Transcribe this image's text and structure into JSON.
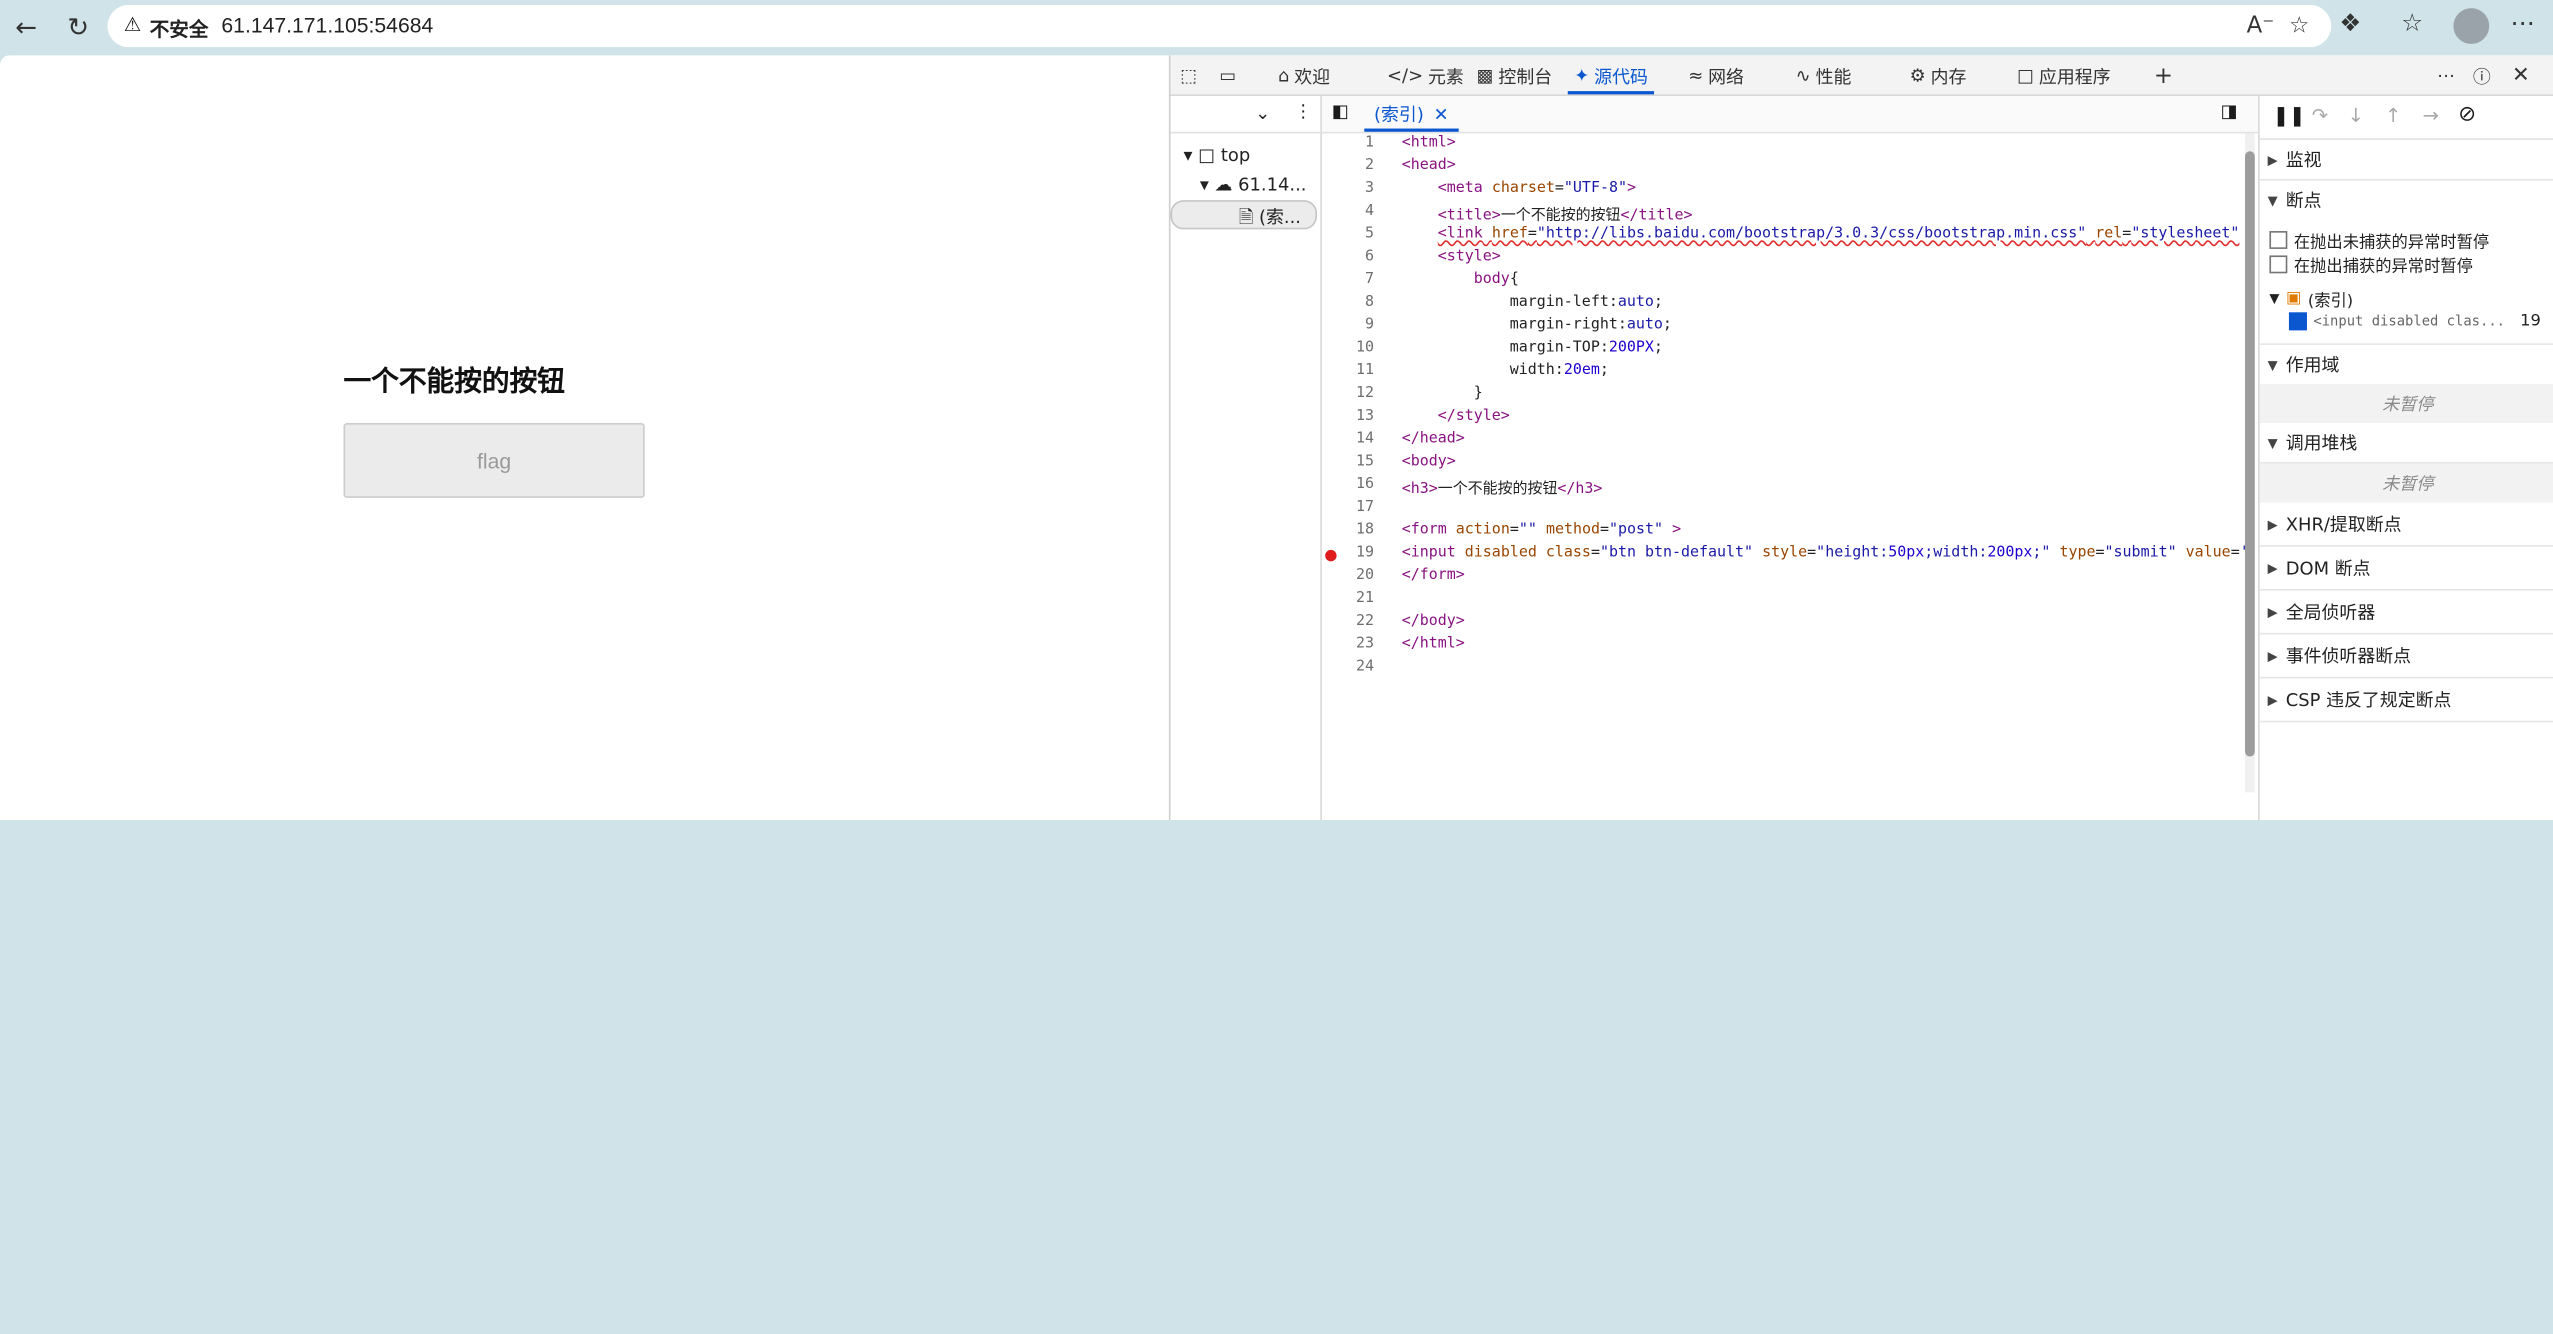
{
  "browser": {
    "insecure_label": "不安全",
    "url": "61.147.171.105:54684"
  },
  "page": {
    "heading": "一个不能按的按钮",
    "button_label": "flag"
  },
  "devtools": {
    "tabs": [
      {
        "label": "欢迎",
        "icon": "home-icon"
      },
      {
        "label": "元素",
        "icon": "code-icon"
      },
      {
        "label": "控制台",
        "icon": "console-icon"
      },
      {
        "label": "源代码",
        "icon": "bug-icon",
        "active": true
      },
      {
        "label": "网络",
        "icon": "wifi-icon"
      },
      {
        "label": "性能",
        "icon": "gauge-icon"
      },
      {
        "label": "内存",
        "icon": "chip-icon"
      },
      {
        "label": "应用程序",
        "icon": "window-icon"
      }
    ],
    "navigator": {
      "top_label": "top",
      "host_label": "61.14...",
      "file_label": "(索..."
    },
    "editor": {
      "file_tab": "(索引)",
      "lines": [
        {
          "n": "1",
          "html": "<span class=\"tag\">&lt;html&gt;</span>"
        },
        {
          "n": "2",
          "html": "<span class=\"tag\">&lt;head&gt;</span>"
        },
        {
          "n": "3",
          "html": "    <span class=\"tag\">&lt;meta</span> <span class=\"attr\">charset</span>=<span class=\"val\">\"UTF-8\"</span><span class=\"tag\">&gt;</span>"
        },
        {
          "n": "4",
          "html": "    <span class=\"tag\">&lt;title&gt;</span>一个不能按的按钮<span class=\"tag\">&lt;/title&gt;</span>"
        },
        {
          "n": "5",
          "html": "    <span class=\"squig\"><span class=\"tag\">&lt;link</span> <span class=\"attr\">href</span>=<span class=\"val\">\"http://libs.baidu.com/bootstrap/3.0.3/css/bootstrap.min.css\"</span> <span class=\"attr\">rel</span>=<span class=\"val\">\"stylesheet\"</span></span>"
        },
        {
          "n": "6",
          "html": "    <span class=\"tag\">&lt;style&gt;</span>"
        },
        {
          "n": "7",
          "html": "        <span class=\"tag\">body</span>{"
        },
        {
          "n": "8",
          "html": "            margin-left:<span class=\"val\">auto</span>;"
        },
        {
          "n": "9",
          "html": "            margin-right:<span class=\"val\">auto</span>;"
        },
        {
          "n": "10",
          "html": "            margin-TOP:<span class=\"num\">200PX</span>;"
        },
        {
          "n": "11",
          "html": "            width:<span class=\"num\">20em</span>;"
        },
        {
          "n": "12",
          "html": "        }"
        },
        {
          "n": "13",
          "html": "    <span class=\"tag\">&lt;/style&gt;</span>"
        },
        {
          "n": "14",
          "html": "<span class=\"tag\">&lt;/head&gt;</span>"
        },
        {
          "n": "15",
          "html": "<span class=\"tag\">&lt;body&gt;</span>"
        },
        {
          "n": "16",
          "html": "<span class=\"tag\">&lt;h3&gt;</span>一个不能按的按钮<span class=\"tag\">&lt;/h3&gt;</span>"
        },
        {
          "n": "17",
          "html": ""
        },
        {
          "n": "18",
          "html": "<span class=\"tag\">&lt;form</span> <span class=\"attr\">action</span>=<span class=\"val\">\"\"</span> <span class=\"attr\">method</span>=<span class=\"val\">\"post\"</span> <span class=\"tag\">&gt;</span>"
        },
        {
          "n": "19",
          "html": "<span class=\"tag\">&lt;input</span> <span class=\"attr\">disabled</span> <span class=\"attr\">class</span>=<span class=\"val\">\"btn btn-default\"</span> <span class=\"attr\">style</span>=<span class=\"val\">\"height:<span class=\"num\">50px</span>;width:<span class=\"num\">200px</span>;\"</span> <span class=\"attr\">type</span>=<span class=\"val\">\"submit\"</span> <span class=\"attr\">value</span>=<span class=\"val\">'</span>",
          "breakpoint": true
        },
        {
          "n": "20",
          "html": "<span class=\"tag\">&lt;/form&gt;</span>"
        },
        {
          "n": "21",
          "html": ""
        },
        {
          "n": "22",
          "html": "<span class=\"tag\">&lt;/body&gt;</span>"
        },
        {
          "n": "23",
          "html": "<span class=\"tag\">&lt;/html&gt;</span>"
        },
        {
          "n": "24",
          "html": ""
        }
      ]
    },
    "debugger": {
      "watch": "监视",
      "breakpoints": "断点",
      "pause_uncaught": "在抛出未捕获的异常时暂停",
      "pause_caught": "在抛出捕获的异常时暂停",
      "bp_file": "(索引)",
      "bp_code": "<input disabled clas...",
      "bp_line": "19",
      "scope": "作用域",
      "not_paused": "未暂停",
      "call_stack": "调用堆栈",
      "xhr": "XHR/提取断点",
      "dom": "DOM 断点",
      "global_listeners": "全局侦听器",
      "event_listener_bp": "事件侦听器断点",
      "csp": "CSP 违反了规定断点"
    }
  }
}
